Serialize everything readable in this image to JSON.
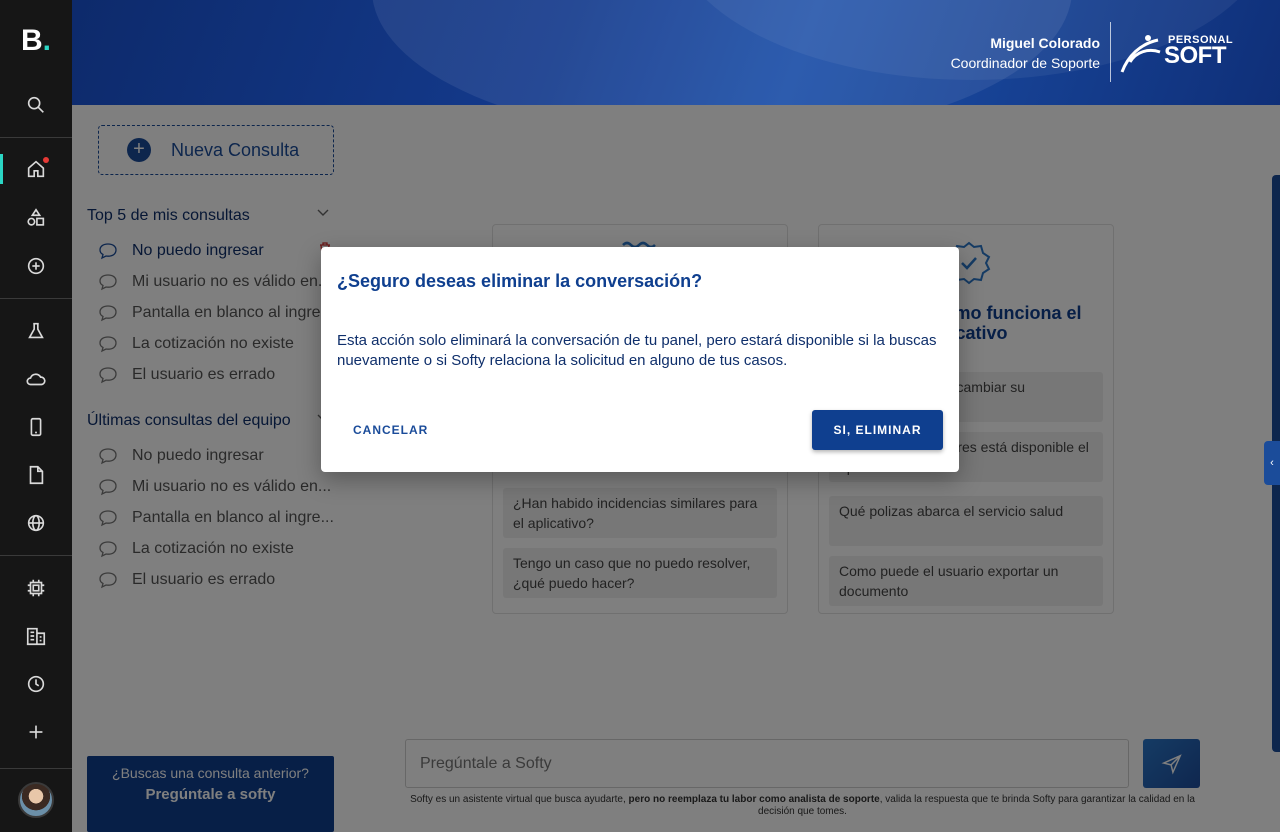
{
  "rail": {
    "logo_letter": "B",
    "logo_dot": ".",
    "icons": [
      "search-icon",
      "home-icon",
      "shapes-icon",
      "add-circle-icon",
      "flask-icon",
      "cloud-icon",
      "mobile-icon",
      "document-icon",
      "globe-icon",
      "chip-icon",
      "building-icon",
      "clock-icon",
      "plus-icon"
    ]
  },
  "header": {
    "user_name": "Miguel Colorado",
    "user_role": "Coordinador de Soporte",
    "brand_top": "PERSONAL",
    "brand_bottom": "SOFT"
  },
  "sidebar": {
    "new_button": "Nueva Consulta",
    "section1_title": "Top 5 de mis consultas",
    "section1_items": [
      "No puedo ingresar",
      "Mi usuario no es válido en...",
      "Pantalla en blanco al ingre...",
      "La cotización no existe",
      "El usuario es errado"
    ],
    "section2_title": "Últimas consultas del equipo",
    "section2_items": [
      "No puedo ingresar",
      "Mi usuario no es válido en...",
      "Pantalla en blanco al ingre...",
      "La cotización no existe",
      "El usuario es errado"
    ],
    "ask_question": "¿Buscas una consulta anterior?",
    "ask_action": "Pregúntale a softy"
  },
  "main": {
    "card_right_title": "Pregunta cómo funciona el aplicativo",
    "card_left_suggestions": [
      "¿Han habido incidencias similares para el aplicativo?",
      "Tengo un caso que no puedo resolver, ¿qué puedo hacer?"
    ],
    "card_right_suggestions": [
      "¿Puede el usuario cambiar su contraseña?",
      "¿En qué navegadores está disponible el aplicativo?",
      "Qué polizas abarca el servicio salud",
      "Como puede el usuario exportar un documento"
    ],
    "chat_placeholder": "Pregúntale a Softy",
    "disclaimer_pre": "Softy es un asistente virtual que busca ayudarte, ",
    "disclaimer_bold": "pero no reemplaza tu labor como analista de soporte",
    "disclaimer_post": ", valida la respuesta que te brinda Softy para garantizar la calidad en la decisión que tomes."
  },
  "modal": {
    "title": "¿Seguro deseas eliminar la conversación?",
    "body": "Esta acción solo eliminará la conversación de tu panel, pero estará disponible si la buscas nuevamente o si Softy relaciona la solicitud en alguno de tus casos.",
    "cancel": "CANCELAR",
    "confirm": "SI, ELIMINAR"
  },
  "colors": {
    "primary": "#0f3f8f",
    "accent": "#2bd6c4",
    "rail_bg": "#161616"
  }
}
